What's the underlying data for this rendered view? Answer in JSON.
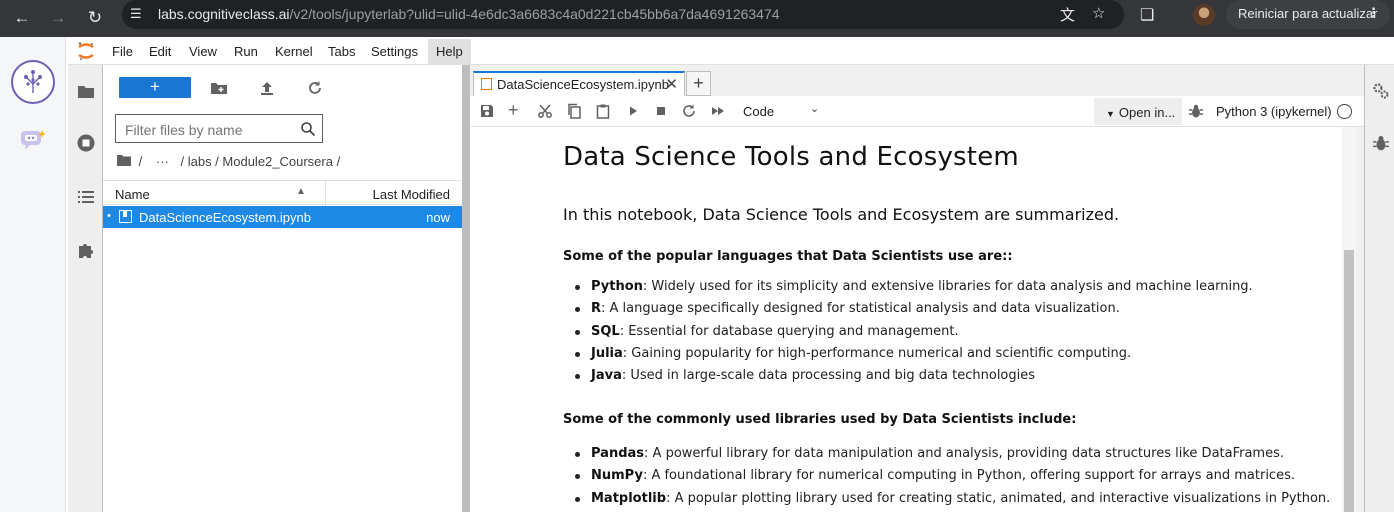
{
  "browser": {
    "url_host": "labs.cognitiveclass.ai",
    "url_rest": "/v2/tools/jupyterlab?ulid=ulid-4e6dc3a6683c4a0d221cb45bb6a7da4691263474",
    "update_button": "Reiniciar para actualizar"
  },
  "menu": [
    "File",
    "Edit",
    "View",
    "Run",
    "Kernel",
    "Tabs",
    "Settings",
    "Help"
  ],
  "filebrowser": {
    "new_label": "+",
    "search_placeholder": "Filter files by name",
    "breadcrumb": [
      "/",
      "···",
      "/ labs / Module2_Coursera /"
    ],
    "col_name": "Name",
    "col_modified": "Last Modified",
    "files": [
      {
        "name": "DataScienceEcosystem.ipynb",
        "modified": "now"
      }
    ]
  },
  "tab": {
    "title": "DataScienceEcosystem.ipynb",
    "add": "+"
  },
  "toolbar": {
    "cell_type": "Code",
    "open_in": "Open in...",
    "kernel": "Python 3 (ipykernel)"
  },
  "notebook": {
    "h1": "Data Science Tools and Ecosystem",
    "h3": "In this notebook, Data Science Tools and Ecosystem are summarized.",
    "languages_intro": "Some of the popular languages that Data Scientists use are::",
    "languages": [
      {
        "name": "Python",
        "desc": ": Widely used for its simplicity and extensive libraries for data analysis and machine learning."
      },
      {
        "name": "R",
        "desc": ": A language specifically designed for statistical analysis and data visualization."
      },
      {
        "name": "SQL",
        "desc": ": Essential for database querying and management."
      },
      {
        "name": "Julia",
        "desc": ": Gaining popularity for high-performance numerical and scientific computing."
      },
      {
        "name": "Java",
        "desc": ": Used in large-scale data processing and big data technologies"
      }
    ],
    "libraries_intro": "Some of the commonly used libraries used by Data Scientists include:",
    "libraries": [
      {
        "name": "Pandas",
        "desc": ": A powerful library for data manipulation and analysis, providing data structures like DataFrames."
      },
      {
        "name": "NumPy",
        "desc": ": A foundational library for numerical computing in Python, offering support for arrays and matrices."
      },
      {
        "name": "Matplotlib",
        "desc": ": A popular plotting library used for creating static, animated, and interactive visualizations in Python."
      }
    ]
  }
}
